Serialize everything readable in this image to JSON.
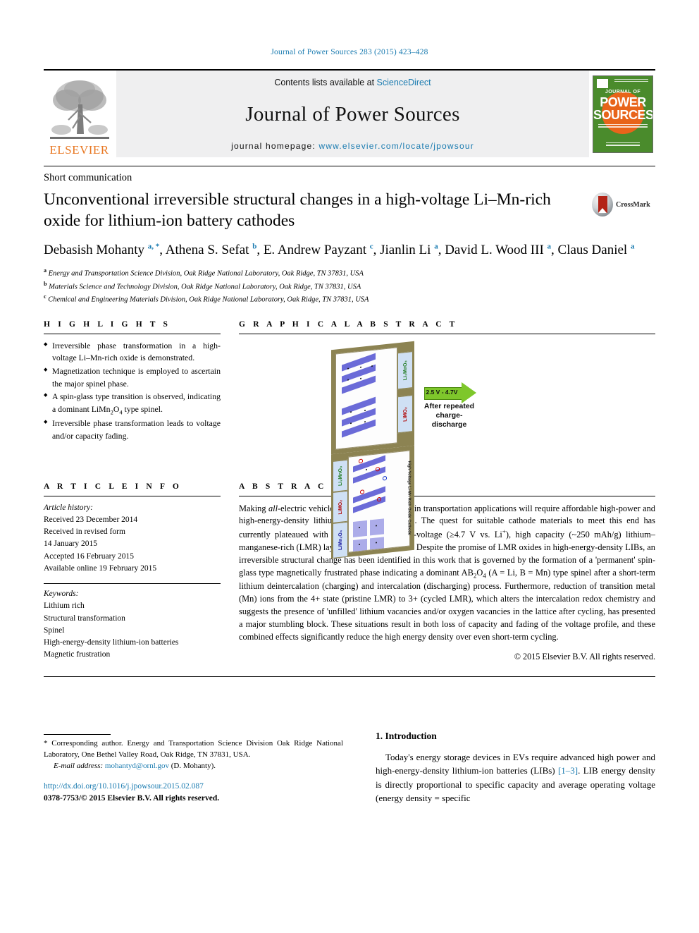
{
  "running_head": "Journal of Power Sources 283 (2015) 423–428",
  "masthead": {
    "contents_prefix": "Contents lists available at ",
    "contents_link": "ScienceDirect",
    "journal_name": "Journal of Power Sources",
    "homepage_prefix": "journal homepage: ",
    "homepage_url": "www.elsevier.com/locate/jpowsour",
    "publisher": "ELSEVIER",
    "cover": {
      "line1": "JOURNAL OF",
      "line2": "POWER",
      "line3": "SOURCES"
    }
  },
  "article": {
    "category": "Short communication",
    "title": "Unconventional irreversible structural changes in a high-voltage Li–Mn-rich oxide for lithium-ion battery cathodes",
    "crossmark_label": "CrossMark",
    "authors_html": "Debasish Mohanty <sup>a, *</sup>, Athena S. Sefat <sup>b</sup>, E. Andrew Payzant <sup>c</sup>, Jianlin Li <sup>a</sup>, David L. Wood III <sup>a</sup>, Claus Daniel <sup>a</sup>",
    "affiliations": [
      {
        "marker": "a",
        "text": "Energy and Transportation Science Division, Oak Ridge National Laboratory, Oak Ridge, TN 37831, USA"
      },
      {
        "marker": "b",
        "text": "Materials Science and Technology Division, Oak Ridge National Laboratory, Oak Ridge, TN 37831, USA"
      },
      {
        "marker": "c",
        "text": "Chemical and Engineering Materials Division, Oak Ridge National Laboratory, Oak Ridge, TN 37831, USA"
      }
    ]
  },
  "highlights": {
    "heading": "H I G H L I G H T S",
    "items": [
      "Irreversible phase transformation in a high-voltage Li–Mn-rich oxide is demonstrated.",
      "Magnetization technique is employed to ascertain the major spinel phase.",
      "A spin-glass type transition is observed, indicating a dominant LiMn<sub>2</sub>O<sub>4</sub> type spinel.",
      "Irreversible phase transformation leads to voltage and/or capacity fading."
    ]
  },
  "graphical_abstract": {
    "heading": "G R A P H I C A L   A B S T R A C T",
    "left_panel_label": "High-Voltage Li-Mn Rich Oxide Cathode",
    "right_panel_label": "High-Voltage Li-Mn Rich Oxide Cathode",
    "left_phases": [
      "Li₂MnO₃",
      "LiMO₂"
    ],
    "right_phases": [
      "Li₂MnO₃",
      "LiMO₂",
      "LiMn₂O₄"
    ],
    "arrow_label": "2.5 V - 4.7V",
    "caption": "After repeated charge-discharge"
  },
  "article_info": {
    "heading": "A R T I C L E   I N F O",
    "history_label": "Article history:",
    "history": [
      "Received 23 December 2014",
      "Received in revised form",
      "14 January 2015",
      "Accepted 16 February 2015",
      "Available online 19 February 2015"
    ],
    "keywords_label": "Keywords:",
    "keywords": [
      "Lithium rich",
      "Structural transformation",
      "Spinel",
      "High-energy-density lithium-ion batteries",
      "Magnetic frustration"
    ]
  },
  "abstract": {
    "heading": "A B S T R A C T",
    "body_html": "Making <i>all</i>-electric vehicles (EVs) commonplace in transportation applications will require affordable high-power and high-energy-density lithium-ion batteries (LIBs). The quest for suitable cathode materials to meet this end has currently plateaued with the discovery of high-voltage (≥4.7 V vs. Li<sup>+</sup>), high capacity (~250 mAh/g) lithium–manganese-rich (LMR) layered composite oxides. Despite the promise of LMR oxides in high-energy-density LIBs, an irreversible structural change has been identified in this work that is governed by the formation of a 'permanent' spin-glass type magnetically frustrated phase indicating a dominant AB<sub>2</sub>O<sub>4</sub> (A = Li, B = Mn) type spinel after a short-term lithium deintercalation (charging) and intercalation (discharging) process. Furthermore, reduction of transition metal (Mn) ions from the 4+ state (pristine LMR) to 3+ (cycled LMR), which alters the intercalation redox chemistry and suggests the presence of 'unfilled' lithium vacancies and/or oxygen vacancies in the lattice after cycling, has presented a major stumbling block. These situations result in both loss of capacity and fading of the voltage profile, and these combined effects significantly reduce the high energy density over even short-term cycling.",
    "copyright": "© 2015 Elsevier B.V. All rights reserved."
  },
  "introduction": {
    "heading": "1. Introduction",
    "paragraph_html": "Today's energy storage devices in EVs require advanced high power and high-energy-density lithium-ion batteries (LIBs) <a>[1–3]</a>. LIB energy density is directly proportional to specific capacity and average operating voltage (energy density = specific"
  },
  "footer": {
    "corresponding_html": "* Corresponding author. Energy and Transportation Science Division Oak Ridge National Laboratory, One Bethel Valley Road, Oak Ridge, TN 37831, USA.",
    "email_label": "E-mail address:",
    "email": "mohantyd@ornl.gov",
    "email_suffix": "(D. Mohanty).",
    "doi": "http://dx.doi.org/10.1016/j.jpowsour.2015.02.087",
    "issn_line": "0378-7753/© 2015 Elsevier B.V. All rights reserved."
  }
}
